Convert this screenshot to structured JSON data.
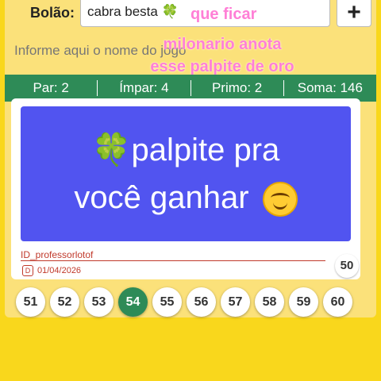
{
  "header": {
    "bolao_label": "Bolão:",
    "bolao_value": "cabra besta 🍀",
    "add_icon": "plus-icon",
    "name_placeholder": "Informe aqui o nome do jogo"
  },
  "overlay_text": {
    "line1": "que ficar",
    "line2": "milonario anota",
    "line3": "esse palpite de oro"
  },
  "stats": {
    "par": "Par: 2",
    "impar": "Ímpar: 4",
    "primo": "Primo: 2",
    "soma": "Soma: 146"
  },
  "card": {
    "line1": "🍀palpite pra",
    "line2": "você ganhar",
    "emoji_icon": "hugging-face-icon"
  },
  "attribution": {
    "id": "ID_professorlotof",
    "date": "01/04/2026",
    "badge": "D"
  },
  "side_balls": [
    "50"
  ],
  "balls": [
    {
      "n": "51",
      "selected": false
    },
    {
      "n": "52",
      "selected": false
    },
    {
      "n": "53",
      "selected": false
    },
    {
      "n": "54",
      "selected": true
    },
    {
      "n": "55",
      "selected": false
    },
    {
      "n": "56",
      "selected": false
    },
    {
      "n": "57",
      "selected": false
    },
    {
      "n": "58",
      "selected": false
    },
    {
      "n": "59",
      "selected": false
    },
    {
      "n": "60",
      "selected": false
    }
  ],
  "colors": {
    "background": "#f9d71c",
    "green": "#2e8b57",
    "card": "#5154f0",
    "pink": "#ff7fd6"
  }
}
